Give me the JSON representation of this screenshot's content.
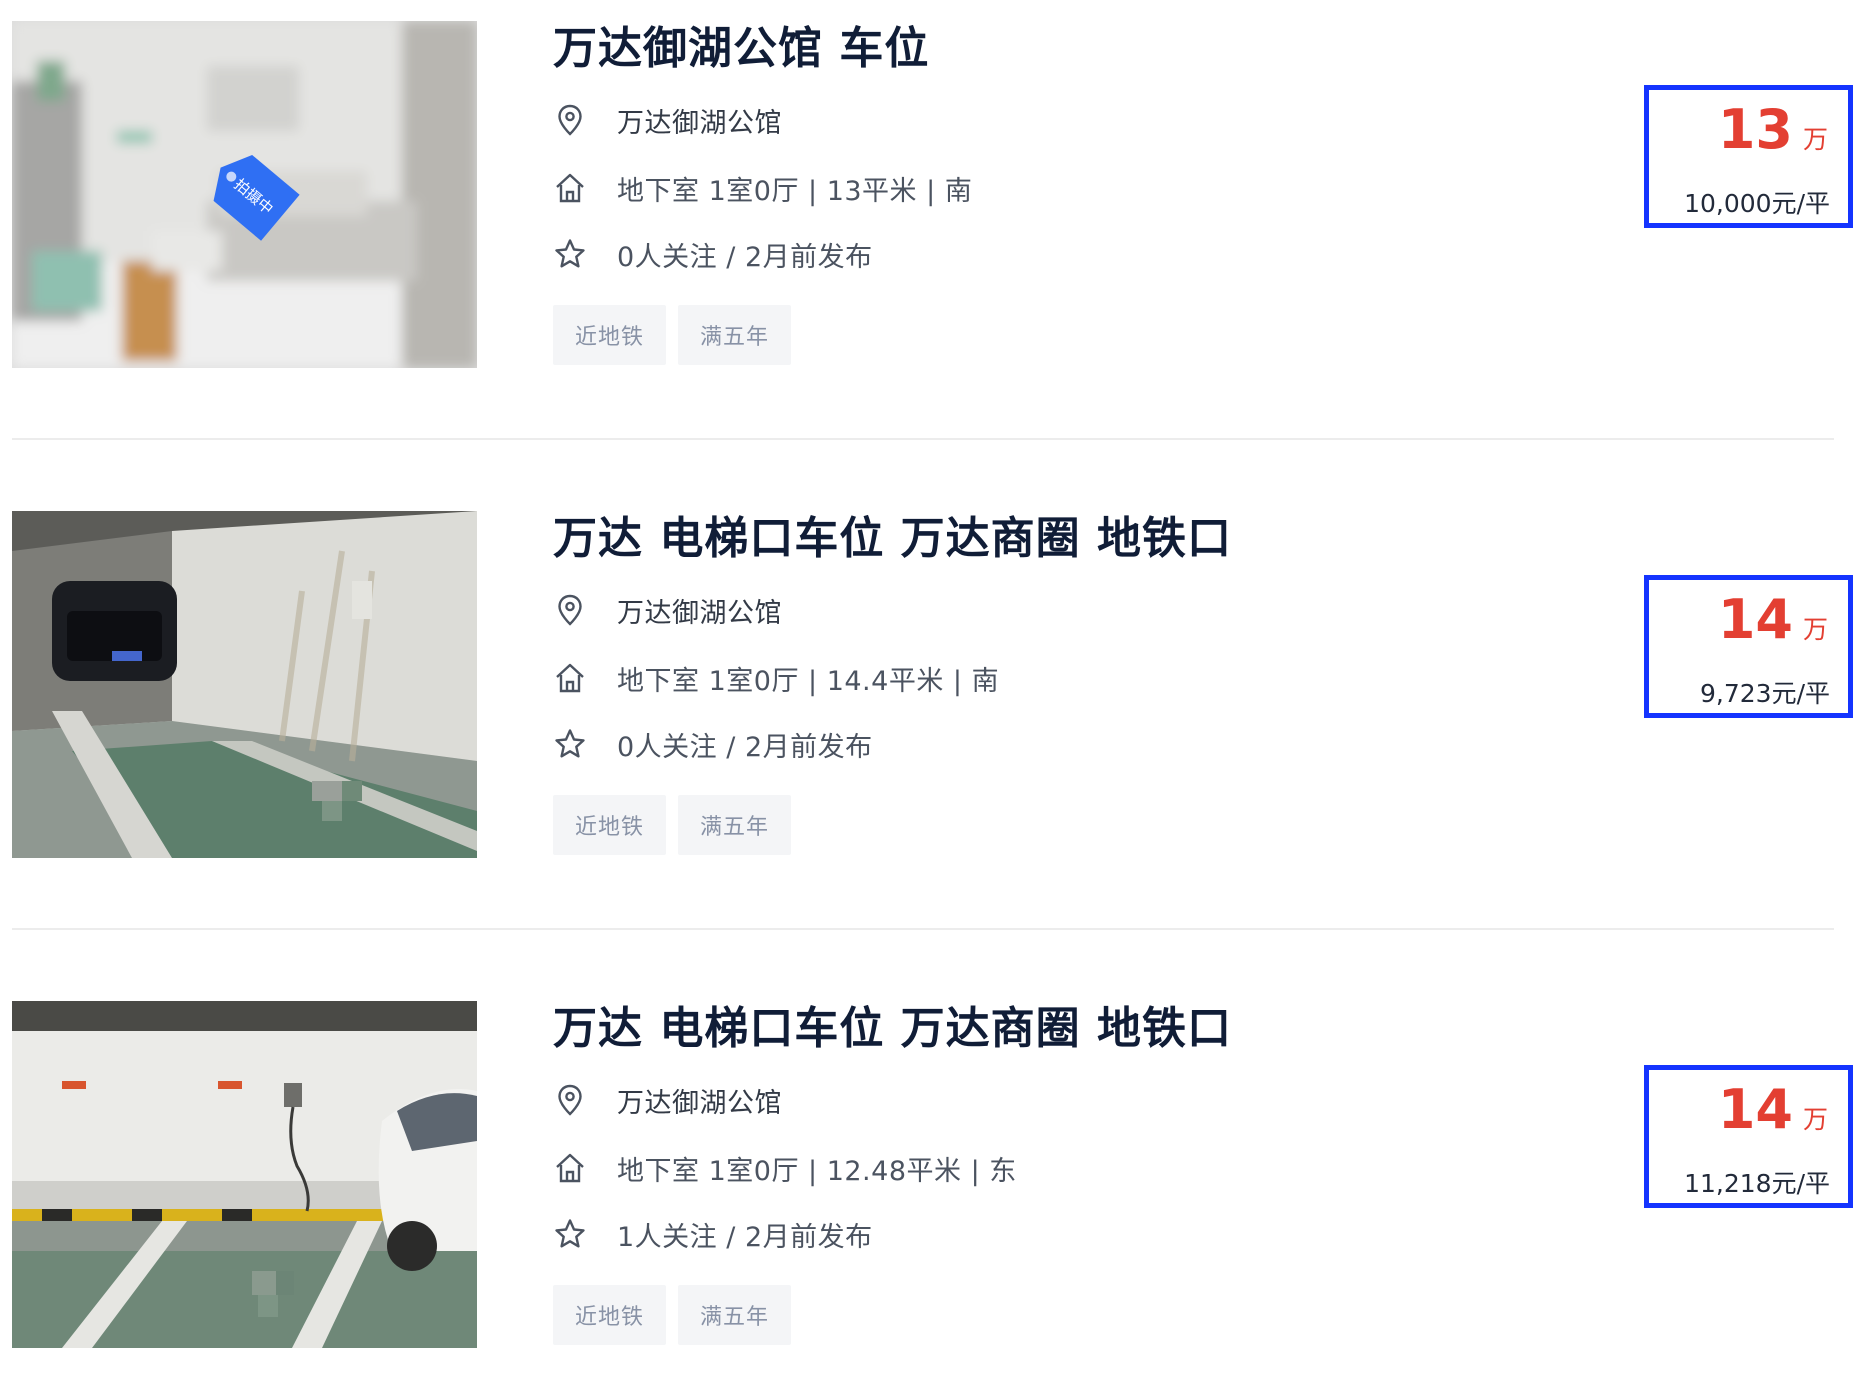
{
  "listings": [
    {
      "title": "万达御湖公馆 车位",
      "community": "万达御湖公馆",
      "house_info": "地下室 1室0厅 | 13平米 | 南",
      "follow_info": "0人关注 / 2月前发布",
      "tags": [
        "近地铁",
        "满五年"
      ],
      "total_price": "13",
      "total_unit": "万",
      "unit_price": "10,000元/平",
      "photo_badge": "拍摄中"
    },
    {
      "title": "万达 电梯口车位 万达商圈 地铁口",
      "community": "万达御湖公馆",
      "house_info": "地下室 1室0厅 | 14.4平米 | 南",
      "follow_info": "0人关注 / 2月前发布",
      "tags": [
        "近地铁",
        "满五年"
      ],
      "total_price": "14",
      "total_unit": "万",
      "unit_price": "9,723元/平"
    },
    {
      "title": "万达 电梯口车位 万达商圈 地铁口",
      "community": "万达御湖公馆",
      "house_info": "地下室 1室0厅 | 12.48平米 | 东",
      "follow_info": "1人关注 / 2月前发布",
      "tags": [
        "近地铁",
        "满五年"
      ],
      "total_price": "14",
      "total_unit": "万",
      "unit_price": "11,218元/平"
    }
  ],
  "icons": {
    "community": "location-pin-icon",
    "house": "house-icon",
    "follow": "star-icon"
  },
  "colors": {
    "title": "#101d37",
    "price": "#e33f32",
    "highlight_border": "#1434ff",
    "tag_bg": "#f4f5f7",
    "tag_text": "#8892a6"
  }
}
